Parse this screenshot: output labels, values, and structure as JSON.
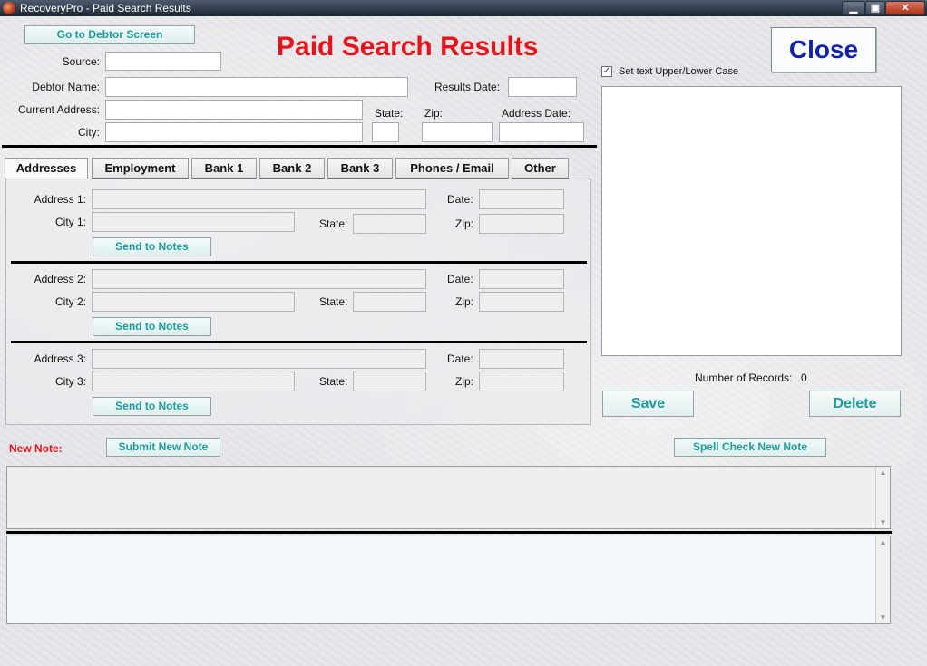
{
  "window": {
    "title": "RecoveryPro - Paid Search Results",
    "controls": {
      "minimize": "▁",
      "maximize": "▣",
      "close": "✕"
    }
  },
  "header": {
    "go_to_debtor_label": "Go to Debtor Screen",
    "page_title": "Paid Search Results",
    "close_label": "Close"
  },
  "form": {
    "source_label": "Source:",
    "debtor_name_label": "Debtor Name:",
    "results_date_label": "Results Date:",
    "current_address_label": "Current Address:",
    "state_label": "State:",
    "zip_label": "Zip:",
    "address_date_label": "Address Date:",
    "city_label": "City:",
    "source": "",
    "debtor_name": "",
    "results_date": "",
    "current_address": "",
    "state": "",
    "zip": "",
    "address_date": "",
    "city": ""
  },
  "tabs": [
    "Addresses",
    "Employment",
    "Bank 1",
    "Bank 2",
    "Bank 3",
    "Phones / Email",
    "Other"
  ],
  "active_tab": "Addresses",
  "addresses": [
    {
      "address_label": "Address 1:",
      "city_label": "City 1:",
      "date_label": "Date:",
      "state_label": "State:",
      "zip_label": "Zip:",
      "send_label": "Send to Notes"
    },
    {
      "address_label": "Address 2:",
      "city_label": "City 2:",
      "date_label": "Date:",
      "state_label": "State:",
      "zip_label": "Zip:",
      "send_label": "Send to Notes"
    },
    {
      "address_label": "Address 3:",
      "city_label": "City 3:",
      "date_label": "Date:",
      "state_label": "State:",
      "zip_label": "Zip:",
      "send_label": "Send to Notes"
    }
  ],
  "notes": {
    "case_checkbox_label": "Set text Upper/Lower Case",
    "case_checked": true,
    "records_label": "Number of Records:",
    "records_count": "0",
    "save_label": "Save",
    "delete_label": "Delete"
  },
  "new_note": {
    "label": "New Note:",
    "submit_label": "Submit New Note",
    "spell_check_label": "Spell Check New Note"
  },
  "colors": {
    "title_red": "#e8121b",
    "teal_text": "#1b9c9c",
    "close_blue": "#1120a8"
  }
}
